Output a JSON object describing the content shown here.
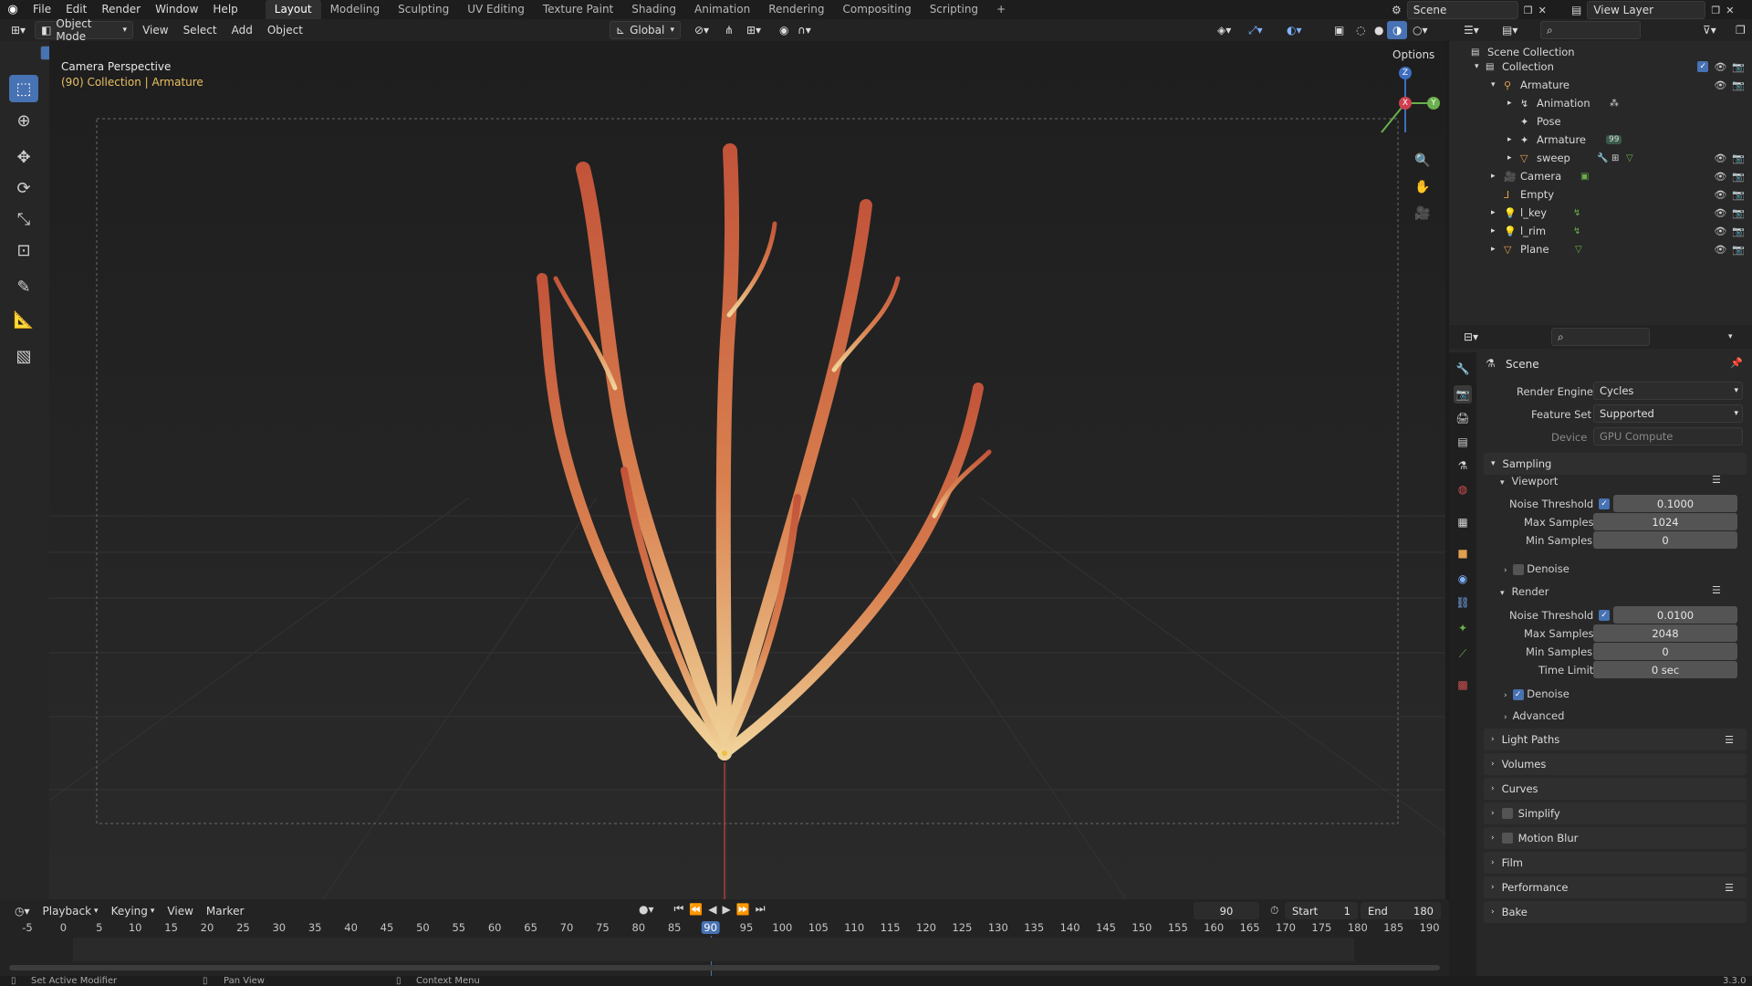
{
  "topbar": {
    "menus": [
      "File",
      "Edit",
      "Render",
      "Window",
      "Help"
    ],
    "workspaces": [
      "Layout",
      "Modeling",
      "Sculpting",
      "UV Editing",
      "Texture Paint",
      "Shading",
      "Animation",
      "Rendering",
      "Compositing",
      "Scripting"
    ],
    "active_workspace": "Layout",
    "add_tab": "+",
    "scene_label": "Scene",
    "view_layer_label": "View Layer"
  },
  "viewport_header": {
    "mode": "Object Mode",
    "menus": [
      "View",
      "Select",
      "Add",
      "Object"
    ],
    "transform_orientation": "Global",
    "options_label": "Options"
  },
  "viewport": {
    "camera_label": "Camera Perspective",
    "collection_info": "(90) Collection | Armature",
    "gizmo": {
      "z": "Z",
      "x": "X",
      "y": "Y"
    }
  },
  "outliner": {
    "rows": [
      {
        "label": "Scene Collection",
        "indent": 0
      },
      {
        "label": "Collection",
        "indent": 1
      },
      {
        "label": "Armature",
        "indent": 2
      },
      {
        "label": "Animation",
        "indent": 3
      },
      {
        "label": "Pose",
        "indent": 3
      },
      {
        "label": "Armature",
        "indent": 3,
        "badge": "99"
      },
      {
        "label": "sweep",
        "indent": 3
      },
      {
        "label": "Camera",
        "indent": 2
      },
      {
        "label": "Empty",
        "indent": 2
      },
      {
        "label": "l_key",
        "indent": 2
      },
      {
        "label": "l_rim",
        "indent": 2
      },
      {
        "label": "Plane",
        "indent": 2
      }
    ]
  },
  "properties": {
    "context": "Scene",
    "render_engine_label": "Render Engine",
    "render_engine": "Cycles",
    "feature_set_label": "Feature Set",
    "feature_set": "Supported",
    "device_label": "Device",
    "device": "GPU Compute",
    "sampling": "Sampling",
    "viewport": {
      "title": "Viewport",
      "noise_threshold_label": "Noise Threshold",
      "noise_threshold": "0.1000",
      "max_samples_label": "Max Samples",
      "max_samples": "1024",
      "min_samples_label": "Min Samples",
      "min_samples": "0",
      "denoise": "Denoise"
    },
    "render": {
      "title": "Render",
      "noise_threshold_label": "Noise Threshold",
      "noise_threshold": "0.0100",
      "max_samples_label": "Max Samples",
      "max_samples": "2048",
      "min_samples_label": "Min Samples",
      "min_samples": "0",
      "time_limit_label": "Time Limit",
      "time_limit": "0 sec",
      "denoise": "Denoise",
      "advanced": "Advanced"
    },
    "sections": [
      "Light Paths",
      "Volumes",
      "Curves",
      "Simplify",
      "Motion Blur",
      "Film",
      "Performance",
      "Bake"
    ]
  },
  "timeline": {
    "menus": [
      "Playback",
      "Keying",
      "View",
      "Marker"
    ],
    "current_frame": "90",
    "start_label": "Start",
    "start": "1",
    "end_label": "End",
    "end": "180",
    "ticks": [
      "-5",
      "0",
      "5",
      "10",
      "15",
      "20",
      "25",
      "30",
      "35",
      "40",
      "45",
      "50",
      "55",
      "60",
      "65",
      "70",
      "75",
      "80",
      "85",
      "90",
      "95",
      "100",
      "105",
      "110",
      "115",
      "120",
      "125",
      "130",
      "135",
      "140",
      "145",
      "150",
      "155",
      "160",
      "165",
      "170",
      "175",
      "180",
      "185",
      "190"
    ]
  },
  "statusbar": {
    "left": "Set Active Modifier",
    "middle": "Pan View",
    "right": "Context Menu",
    "version": "3.3.0"
  }
}
